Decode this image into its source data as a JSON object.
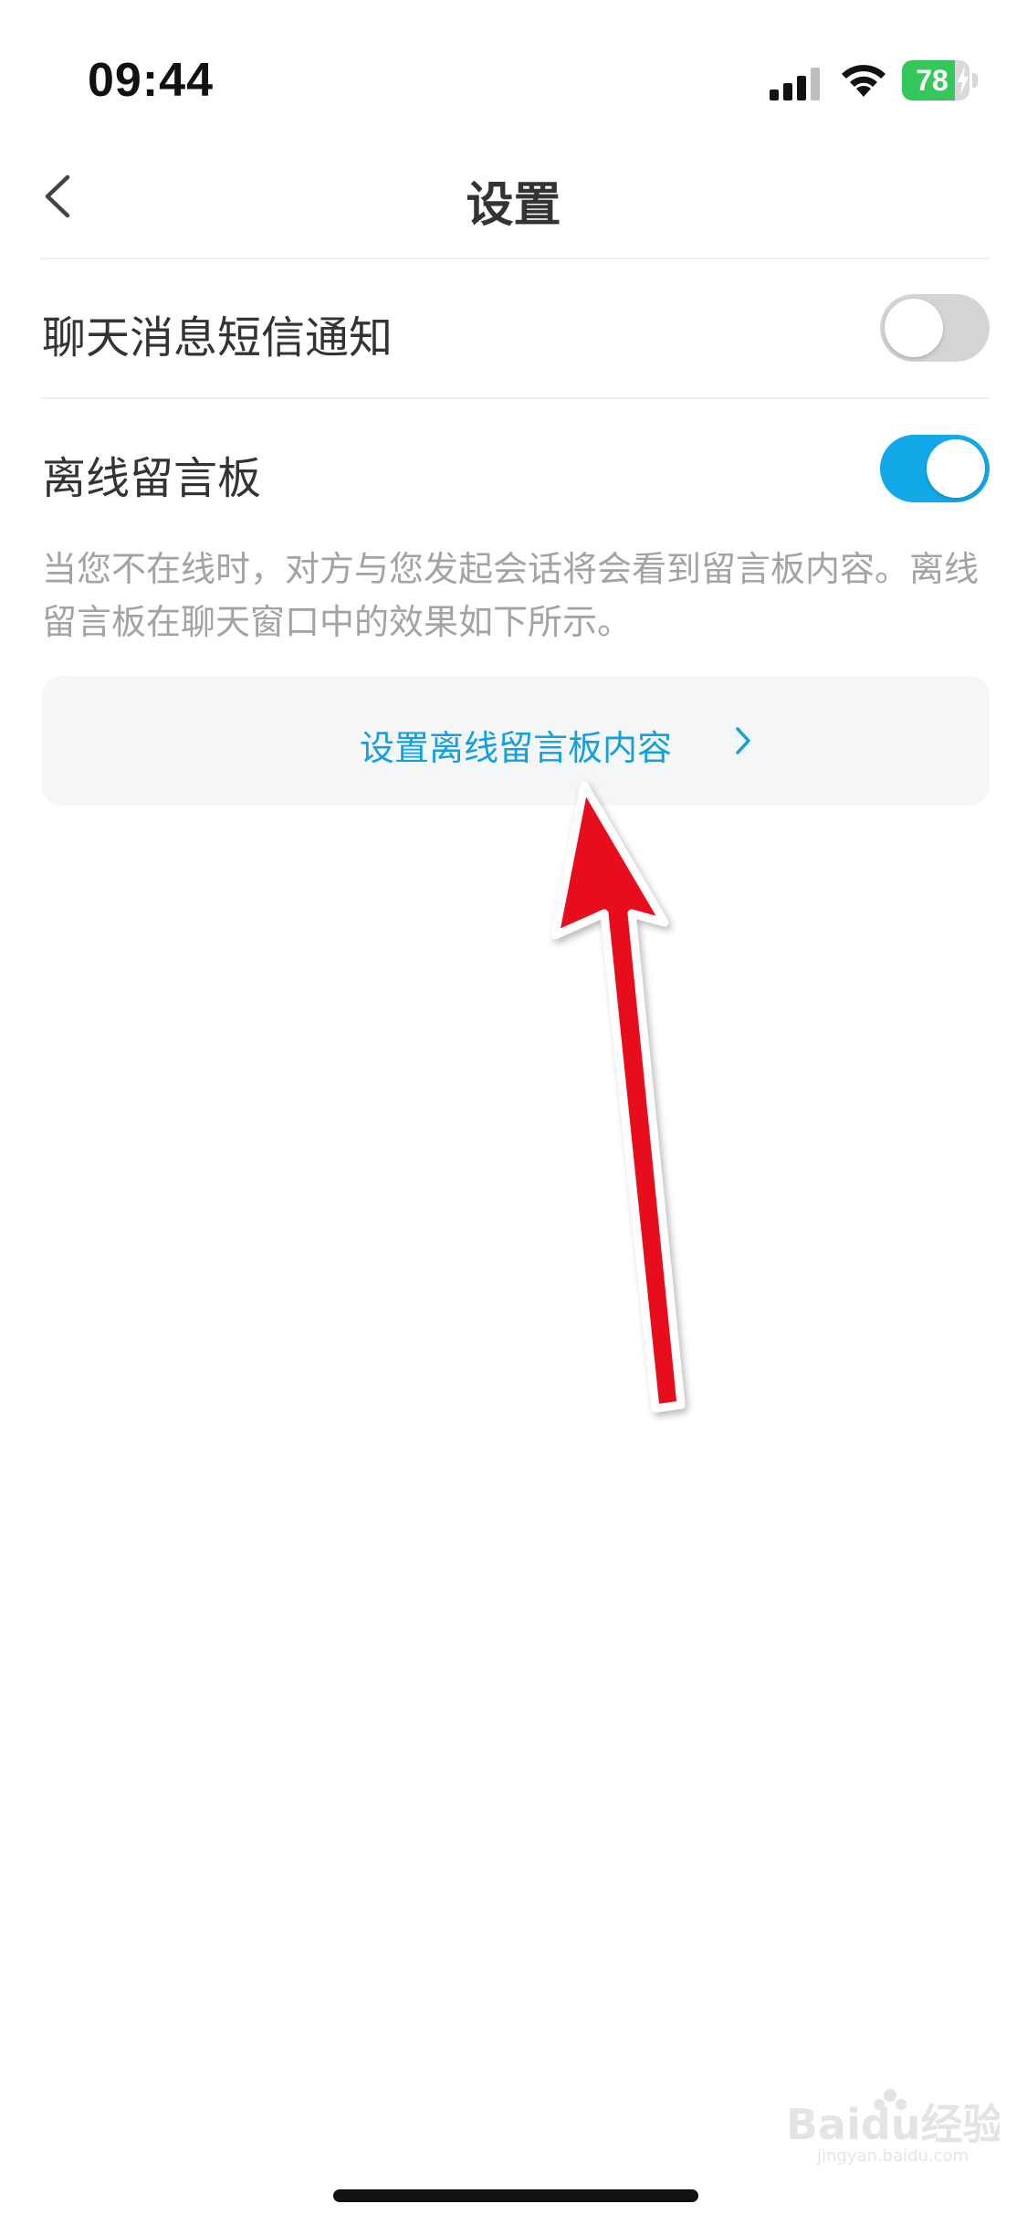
{
  "status_bar": {
    "time": "09:44",
    "battery_percent": "78",
    "battery_level": 0.78,
    "signal_icon": "cellular-signal-icon",
    "wifi_icon": "wifi-icon"
  },
  "nav": {
    "back_icon": "chevron-left-icon",
    "title": "设置"
  },
  "settings": {
    "sms_notification": {
      "label": "聊天消息短信通知",
      "enabled": false
    },
    "offline_board": {
      "label": "离线留言板",
      "enabled": true,
      "description": "当您不在线时，对方与您发起会话将会看到留言板内容。离线留言板在聊天窗口中的效果如下所示。"
    },
    "set_content_link": {
      "label": "设置离线留言板内容",
      "icon": "chevron-right-icon"
    }
  },
  "annotation": {
    "arrow_color": "#e8101a",
    "icon": "red-arrow-icon"
  },
  "watermark": {
    "text": "Baidu经验",
    "url_text": "jingyan.baidu.com"
  },
  "colors": {
    "accent": "#12a9e8",
    "link": "#12a0de",
    "toggle_off": "#d4d4d4",
    "battery_green": "#34c759"
  }
}
